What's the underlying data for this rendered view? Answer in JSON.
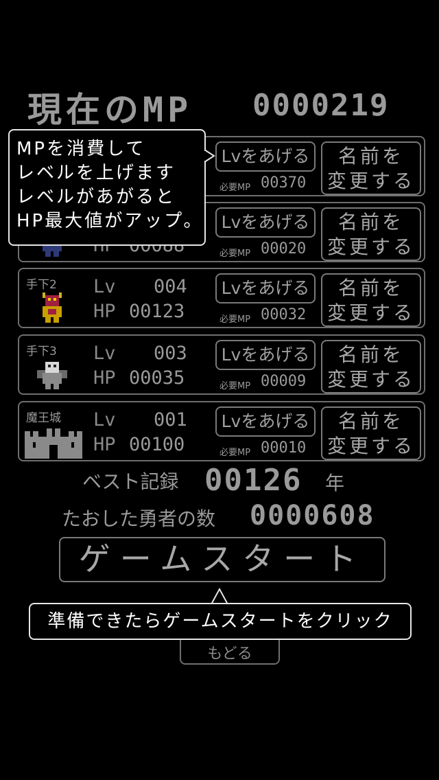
{
  "header": {
    "mp_label": "現在のMP",
    "mp_value": "0000219"
  },
  "units": [
    {
      "name": "",
      "lv_label": "Lv",
      "lv": "",
      "hp_label": "HP",
      "hp": "",
      "lv_button": "Lvをあげる",
      "req_label": "必要MP",
      "req_mp": "00370",
      "name_button_l1": "名前を",
      "name_button_l2": "変更する"
    },
    {
      "name": "",
      "lv_label": "Lv",
      "lv": "",
      "hp_label": "HP",
      "hp": "00088",
      "lv_button": "Lvをあげる",
      "req_label": "必要MP",
      "req_mp": "00020",
      "name_button_l1": "名前を",
      "name_button_l2": "変更する"
    },
    {
      "name": "手下2",
      "lv_label": "Lv",
      "lv": "004",
      "hp_label": "HP",
      "hp": "00123",
      "lv_button": "Lvをあげる",
      "req_label": "必要MP",
      "req_mp": "00032",
      "name_button_l1": "名前を",
      "name_button_l2": "変更する"
    },
    {
      "name": "手下3",
      "lv_label": "Lv",
      "lv": "003",
      "hp_label": "HP",
      "hp": "00035",
      "lv_button": "Lvをあげる",
      "req_label": "必要MP",
      "req_mp": "00009",
      "name_button_l1": "名前を",
      "name_button_l2": "変更する"
    },
    {
      "name": "魔王城",
      "lv_label": "Lv",
      "lv": "001",
      "hp_label": "HP",
      "hp": "00100",
      "lv_button": "Lvをあげる",
      "req_label": "必要MP",
      "req_mp": "00010",
      "name_button_l1": "名前を",
      "name_button_l2": "変更する"
    }
  ],
  "records": {
    "best_label": "ベスト記録",
    "best_value": "00126",
    "best_unit": "年",
    "killed_label": "たおした勇者の数",
    "killed_value": "0000608"
  },
  "start_button": "ゲームスタート",
  "back_button": "もどる",
  "tips": {
    "top_lines": [
      "MPを消費して",
      "レベルを上げます",
      "レベルがあがると",
      "HP最大値がアップ。"
    ],
    "bottom": "準備できたらゲームスタートをクリック"
  },
  "colors": {
    "background": "#000000",
    "text": "#9a9a9a",
    "tooltip_border": "#e6e6e6",
    "tooltip_text": "#ffffff"
  },
  "icons": [
    "hero-sprite",
    "minion-1-sprite",
    "minion-2-sprite",
    "minion-3-sprite",
    "castle-sprite"
  ]
}
